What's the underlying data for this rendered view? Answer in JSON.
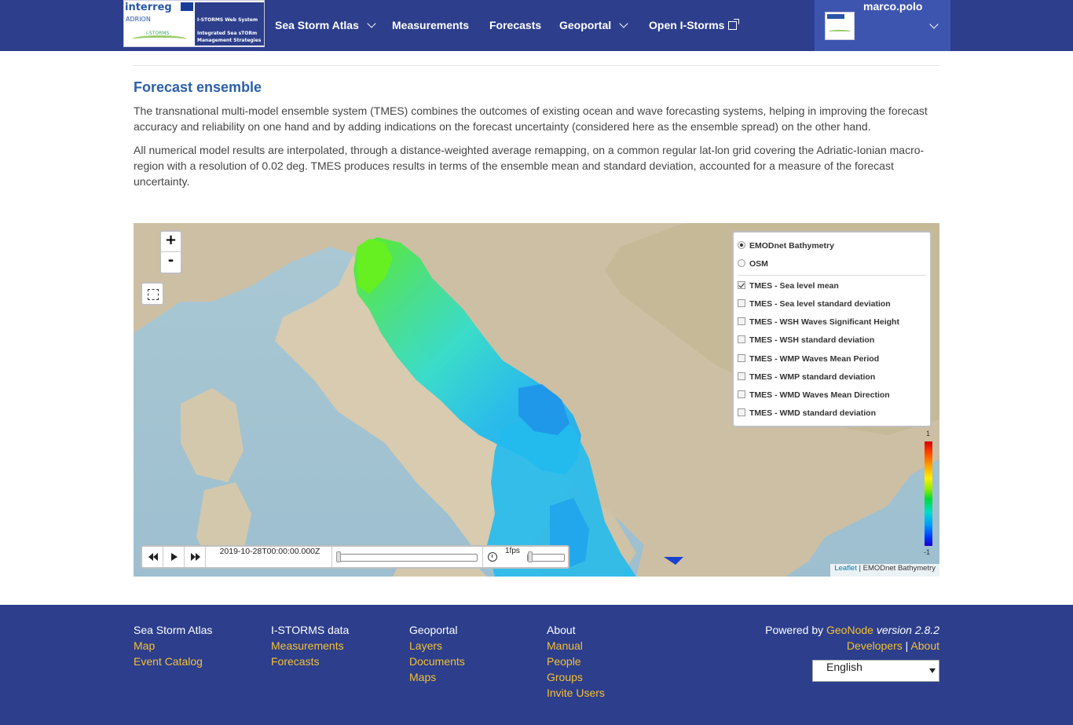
{
  "nav": {
    "logo": {
      "interreg": "interreg",
      "adrion": "ADRION",
      "istorms_small": "I-STORMS",
      "line1": "I-STORMS Web System",
      "line2": "Integrated Sea sTORm",
      "line3": "Management Strategies"
    },
    "items": [
      {
        "label": "Sea Storm Atlas",
        "has_menu": true
      },
      {
        "label": "Measurements",
        "has_menu": false
      },
      {
        "label": "Forecasts",
        "has_menu": false
      },
      {
        "label": "Geoportal",
        "has_menu": true
      },
      {
        "label": "Open I-Storms",
        "icon": "external-link-icon"
      }
    ],
    "user": {
      "name": "marco.polo"
    }
  },
  "page": {
    "title": "Forecast ensemble",
    "paragraphs": [
      "The transnational multi-model ensemble system (TMES) combines the outcomes of existing ocean and wave forecasting systems, helping in improving the forecast accuracy and reliability on one hand and by adding indications on the forecast uncertainty (considered here as the ensemble spread) on the other hand.",
      "All numerical model results are interpolated, through a distance-weighted average remapping, on a common regular lat-lon grid covering the Adriatic-Ionian macro-region with a resolution of 0.02 deg. TMES produces results in terms of the ensemble mean and standard deviation, accounted for a measure of the forecast uncertainty."
    ]
  },
  "map": {
    "zoom_in": "+",
    "zoom_out": "-",
    "base_layers": [
      {
        "label": "EMODnet Bathymetry",
        "selected": true
      },
      {
        "label": "OSM",
        "selected": false
      }
    ],
    "overlays": [
      {
        "label": "TMES - Sea level mean",
        "checked": true
      },
      {
        "label": "TMES - Sea level standard deviation",
        "checked": false
      },
      {
        "label": "TMES - WSH Waves Significant Height",
        "checked": false
      },
      {
        "label": "TMES - WSH standard deviation",
        "checked": false
      },
      {
        "label": "TMES - WMP Waves Mean Period",
        "checked": false
      },
      {
        "label": "TMES - WMP standard deviation",
        "checked": false
      },
      {
        "label": "TMES - WMD Waves Mean Direction",
        "checked": false
      },
      {
        "label": "TMES - WMD standard deviation",
        "checked": false
      }
    ],
    "legend": {
      "max": "1",
      "min": "-1"
    },
    "time": {
      "current": "2019-10-28T00:00:00.000Z",
      "speed": "1fps",
      "position": 0.0
    },
    "attribution": {
      "link": "Leaflet",
      "sep": " | ",
      "text": "EMODnet Bathymetry"
    }
  },
  "footer": {
    "col1": {
      "heading": "Sea Storm Atlas",
      "links": [
        "Map",
        "Event Catalog"
      ]
    },
    "col2": {
      "heading": "I-STORMS data",
      "links": [
        "Measurements",
        "Forecasts"
      ]
    },
    "col3": {
      "heading": "Geoportal",
      "links": [
        "Layers",
        "Documents",
        "Maps"
      ]
    },
    "col4": {
      "heading": "About",
      "links": [
        "Manual",
        "People",
        "Groups",
        "Invite Users"
      ]
    },
    "powered": {
      "prefix": "Powered by ",
      "brand": "GeoNode",
      "version": "version 2.8.2",
      "dev": "Developers",
      "sep": " | ",
      "about": "About"
    },
    "language": "English"
  },
  "colors": {
    "navbar": "#2c3e8c",
    "accent_link": "#f5c033",
    "title": "#2c5fa8"
  }
}
